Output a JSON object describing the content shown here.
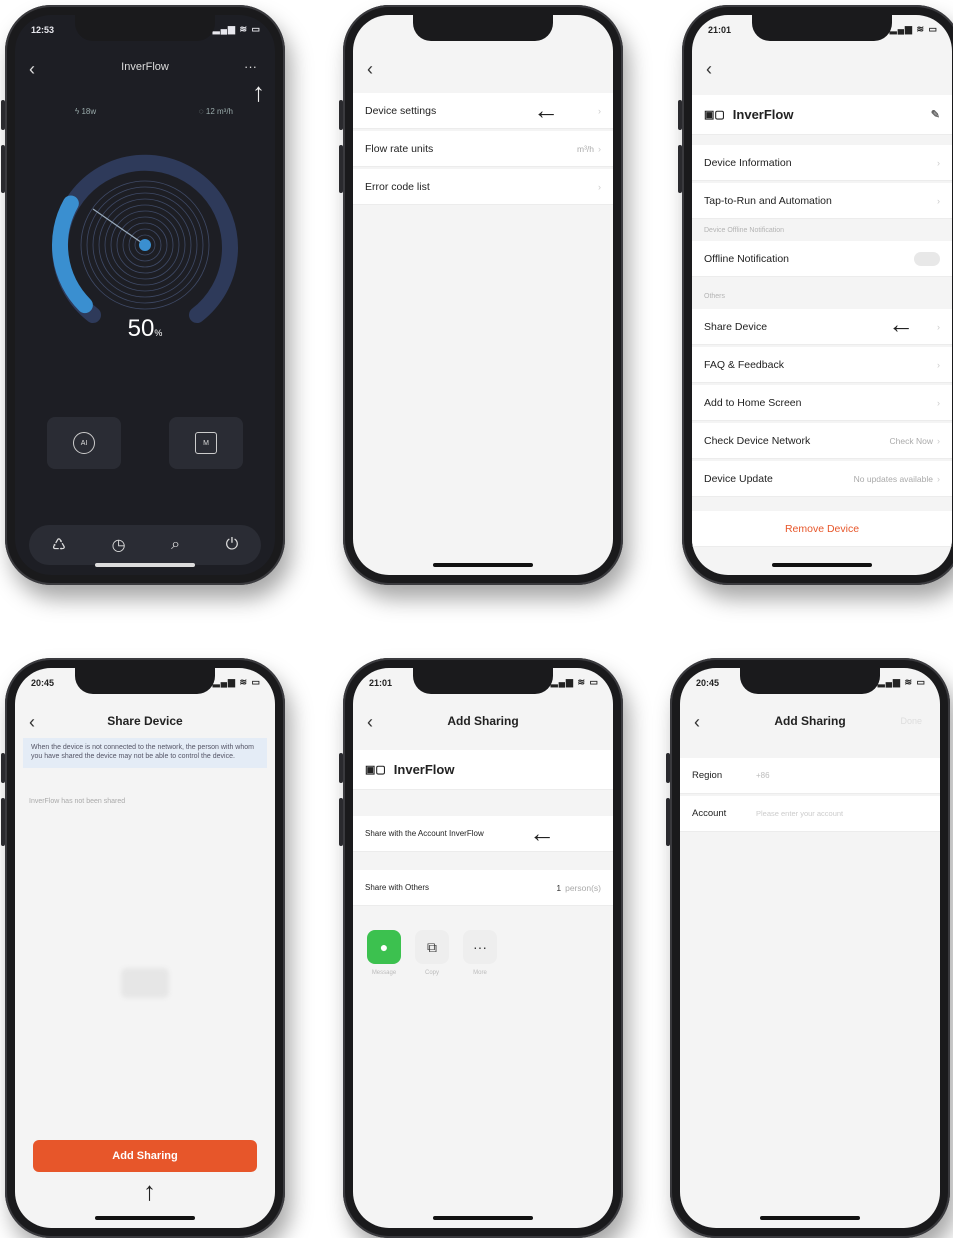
{
  "phone1": {
    "time": "12:53",
    "status_icons": "▂▄▆ ≋ ▭",
    "title": "InverFlow",
    "more": "···",
    "power_stat": "18w",
    "flow_stat": "12 m³/h",
    "percent": "50",
    "percent_unit": "%",
    "mode_ai": "AI",
    "mode_manual": "M",
    "progress": 0.5
  },
  "phone2": {
    "items": [
      {
        "label": "Device settings",
        "value": ""
      },
      {
        "label": "Flow rate units",
        "value": "m³/h"
      },
      {
        "label": "Error code list",
        "value": ""
      }
    ]
  },
  "phone3": {
    "time": "21:01",
    "status_icons": "▂▄▆ ≋ ▭",
    "device_name": "InverFlow",
    "device_information": "Device Information",
    "tap_to_run": "Tap-to-Run and Automation",
    "section_offline": "Device Offline Notification",
    "offline_notification": "Offline Notification",
    "section_others": "Others",
    "share_device": "Share Device",
    "faq": "FAQ & Feedback",
    "add_home": "Add to Home Screen",
    "check_network": "Check Device Network",
    "check_network_value": "Check Now",
    "device_update": "Device Update",
    "device_update_value": "No updates available",
    "remove_device": "Remove Device"
  },
  "phone4": {
    "time": "20:45",
    "status_icons": "▂▄▆ ≋ ▭",
    "title": "Share Device",
    "notice": "When the device is not connected to the network, the person with whom you have shared the device may not be able to control the device.",
    "empty_state": "InverFlow has not been shared",
    "add_sharing": "Add Sharing"
  },
  "phone5": {
    "time": "21:01",
    "status_icons": "▂▄▆ ≋ ▭",
    "title": "Add Sharing",
    "device_name": "InverFlow",
    "share_account": "Share with the Account InverFlow",
    "share_others": "Share with Others",
    "share_count": "1",
    "share_count_unit": "person(s)",
    "icons": [
      {
        "label": "Message"
      },
      {
        "label": "Copy"
      },
      {
        "label": "More"
      }
    ]
  },
  "phone6": {
    "time": "20:45",
    "status_icons": "▂▄▆ ≋ ▭",
    "title": "Add Sharing",
    "done": "Done",
    "region_label": "Region",
    "region_value": "+86",
    "account_label": "Account",
    "account_placeholder": "Please enter your account"
  },
  "colors": {
    "accent": "#e7562a",
    "dark_bg": "#1d1e24",
    "gauge_blue": "#3a8fd0"
  }
}
